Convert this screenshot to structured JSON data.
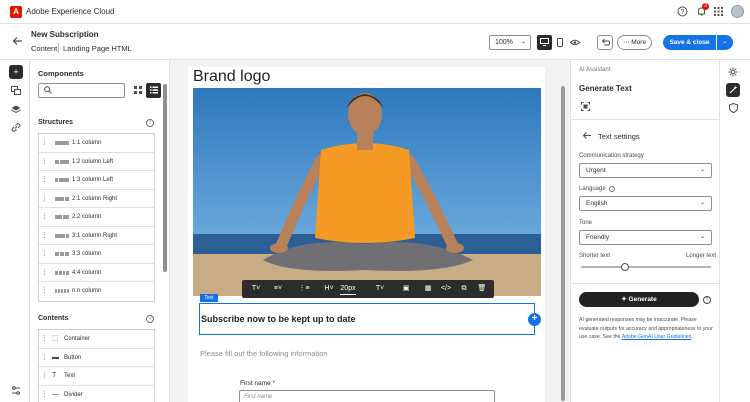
{
  "app": {
    "title": "Adobe Experience Cloud",
    "logo_letter": "A",
    "notifications_count": "3"
  },
  "header": {
    "title": "New Subscription",
    "breadcrumbs": [
      "Content",
      "Landing Page HTML"
    ],
    "zoom": "100%",
    "more_label": "More",
    "save_label": "Save & close"
  },
  "components": {
    "title": "Components",
    "structures_title": "Structures",
    "structures": [
      {
        "label": "1:1 column",
        "ratio": [
          1
        ]
      },
      {
        "label": "1:2 column Left",
        "ratio": [
          1,
          2
        ]
      },
      {
        "label": "1:3 column Left",
        "ratio": [
          1,
          3
        ]
      },
      {
        "label": "2:1 column Right",
        "ratio": [
          2,
          1
        ]
      },
      {
        "label": "2:2 column",
        "ratio": [
          1,
          1
        ]
      },
      {
        "label": "3:1 column Right",
        "ratio": [
          3,
          1
        ]
      },
      {
        "label": "3:3 column",
        "ratio": [
          1,
          1,
          1
        ]
      },
      {
        "label": "4:4 column",
        "ratio": [
          1,
          1,
          1,
          1
        ]
      },
      {
        "label": "n:n column",
        "ratio": [
          1,
          1,
          1,
          1,
          1
        ]
      }
    ],
    "contents_title": "Contents",
    "contents": [
      {
        "label": "Container",
        "icon": "container-icon"
      },
      {
        "label": "Button",
        "icon": "button-icon"
      },
      {
        "label": "Text",
        "icon": "text-icon"
      },
      {
        "label": "Divider",
        "icon": "divider-icon"
      }
    ]
  },
  "canvas": {
    "brand": "Brand logo",
    "toolbar": {
      "font_size": "20px"
    },
    "text_tag": "Text",
    "headline": "Subscribe now to be kept up to date",
    "subtext": "Please fill out the following information",
    "first_name_label": "First name",
    "required_mark": "*",
    "first_name_placeholder": "First name"
  },
  "ai": {
    "section_label": "AI Assistant",
    "title": "Generate Text",
    "settings_title": "Text settings",
    "strategy_label": "Communication strategy",
    "strategy_value": "Urgent",
    "language_label": "Language",
    "language_value": "English",
    "tone_label": "Tone",
    "tone_value": "Friendly",
    "shorter_label": "Shorter text",
    "longer_label": "Longer text",
    "length_level": 0.34,
    "generate_label": "Generate",
    "disclaimer_text": "AI generated responses may be inaccurate. Please evaluate outputs for accuracy and appropriateness to your use case. See the",
    "disclaimer_link": "Adobe GenAI User Guidelines",
    "disclaimer_end": "."
  },
  "colors": {
    "accent": "#1473e6",
    "brand_red": "#eb1000",
    "badge_red": "#d31510",
    "shirt": "#f59a24",
    "sky": "#3f86c5"
  }
}
